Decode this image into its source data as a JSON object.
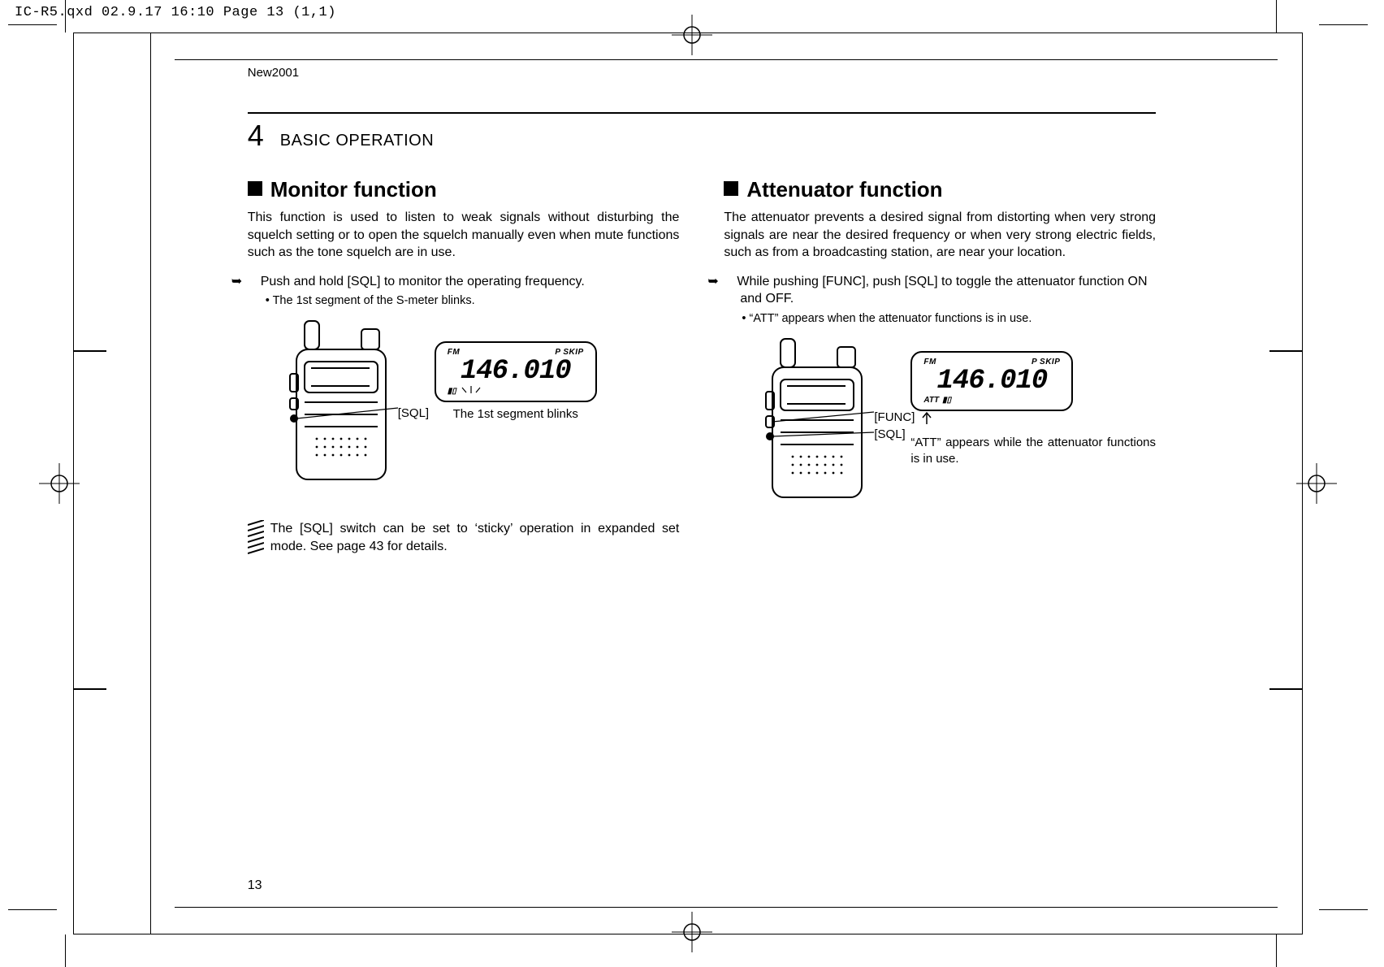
{
  "prepress_header": "IC-R5.qxd  02.9.17 16:10  Page 13 (1,1)",
  "running_head": "New2001",
  "chapter": {
    "number": "4",
    "title": "BASIC OPERATION"
  },
  "page_number": "13",
  "left": {
    "heading": "Monitor function",
    "intro": "This function is used to listen to weak signals without disturbing the squelch setting or to open the squelch manually even when mute functions such as the tone squelch are in use.",
    "step": "Push and hold [SQL] to monitor the operating frequency.",
    "substep": "The 1st segment of the S-meter blinks.",
    "button_label_sql": "[SQL]",
    "lcd": {
      "fm": "FM",
      "pskip": "P SKIP",
      "freq": "146.010",
      "smeter": "▮▯"
    },
    "caption": "The 1st segment blinks",
    "note": "The [SQL] switch can be set to ‘sticky’ operation in expanded set mode. See page 43 for details."
  },
  "right": {
    "heading": "Attenuator function",
    "intro": "The attenuator prevents a desired signal from distorting when very strong signals are near the desired frequency or when very strong electric fields, such as from a broadcasting station, are near your location.",
    "step": "While pushing [FUNC], push [SQL] to toggle the attenuator function ON and OFF.",
    "substep": "“ATT” appears when the attenuator functions is in use.",
    "button_label_func": "[FUNC]",
    "button_label_sql": "[SQL]",
    "lcd": {
      "fm": "FM",
      "pskip": "P SKIP",
      "freq": "146.010",
      "att": "ATT",
      "smeter": "▮▯"
    },
    "caption": "“ATT” appears while the attenuator functions is in use."
  }
}
